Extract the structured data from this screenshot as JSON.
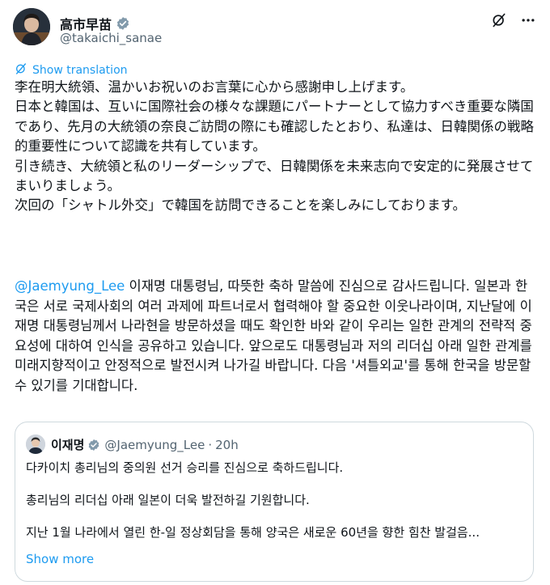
{
  "post": {
    "author": {
      "name": "高市早苗",
      "handle": "@takaichi_sanae",
      "verified_color": "#829aab"
    },
    "translate_label": "Show translation",
    "japanese_paragraphs": [
      "李在明大統領、温かいお祝いのお言葉に心から感謝申し上げます。",
      "日本と韓国は、互いに国際社会の様々な課題にパートナーとして協力すべき重要な隣国であり、先月の大統領の奈良ご訪問の際にも確認したとおり、私達は、日韓関係の戦略的重要性について認識を共有しています。",
      "引き続き、大統領と私のリーダーシップで、日韓関係を未来志向で安定的に発展させてまいりましょう。",
      "次回の「シャトル外交」で韓国を訪問できることを楽しみにしております。"
    ],
    "korean": {
      "mention": "@Jaemyung_Lee",
      "text": " 이재명 대통령님, 따뜻한 축하 말씀에 진심으로 감사드립니다. 일본과 한국은 서로 국제사회의 여러 과제에 파트너로서 협력해야 할 중요한 이웃나라이며, 지난달에 이재명 대통령님께서 나라현을 방문하셨을 때도 확인한 바와 같이 우리는 일한 관계의 전략적 중요성에 대하여 인식을 공유하고 있습니다. 앞으로도 대통령님과 저의 리더십 아래 일한 관계를 미래지향적이고 안정적으로 발전시켜 나가길 바랍니다. 다음 '셔틀외교'를 통해 한국을 방문할 수 있기를 기대합니다."
    }
  },
  "quoted_post": {
    "author_name": "이재명",
    "handle": "@Jaemyung_Lee",
    "separator": "·",
    "time": "20h",
    "verified_color": "#829aab",
    "lines": [
      "다카이치 총리님의 중의원 선거 승리를 진심으로 축하드립니다.",
      "총리님의 리더십 아래 일본이 더욱 발전하길 기원합니다.",
      "지난 1월 나라에서 열린 한-일 정상회담을 통해 양국은 새로운 60년을 향한 힘찬 발걸음..."
    ],
    "show_more_label": "Show more"
  },
  "icons": {
    "header": [
      "grok-icon",
      "more-options-icon"
    ],
    "translate": "translate-icon",
    "accent_color": "#1d9bf0"
  }
}
